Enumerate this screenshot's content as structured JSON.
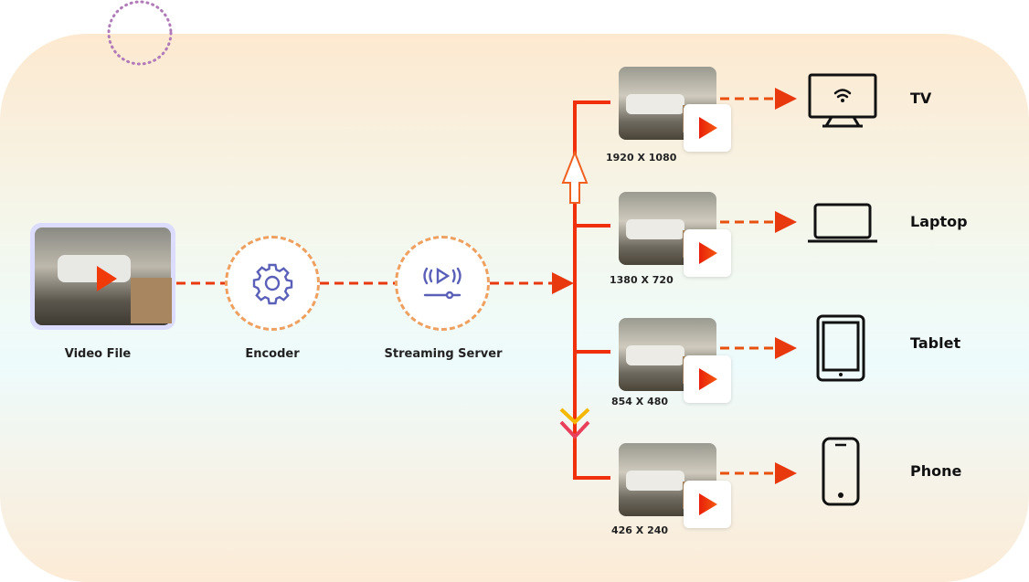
{
  "pipeline": [
    {
      "label": "Video File",
      "icon": "video-thumbnail"
    },
    {
      "label": "Encoder",
      "icon": "gear-icon"
    },
    {
      "label": "Streaming Server",
      "icon": "streaming-icon"
    }
  ],
  "renditions": [
    {
      "resolution": "1920 X 1080",
      "device": "TV",
      "icon": "tv-icon"
    },
    {
      "resolution": "1380 X 720",
      "device": "Laptop",
      "icon": "laptop-icon"
    },
    {
      "resolution": "854 X 480",
      "device": "Tablet",
      "icon": "tablet-icon"
    },
    {
      "resolution": "426 X 240",
      "device": "Phone",
      "icon": "phone-icon"
    }
  ],
  "colors": {
    "arrow": "#e8380d",
    "circle_border": "#eea060",
    "icon": "#5a60b8",
    "play": "#f03a0a"
  }
}
